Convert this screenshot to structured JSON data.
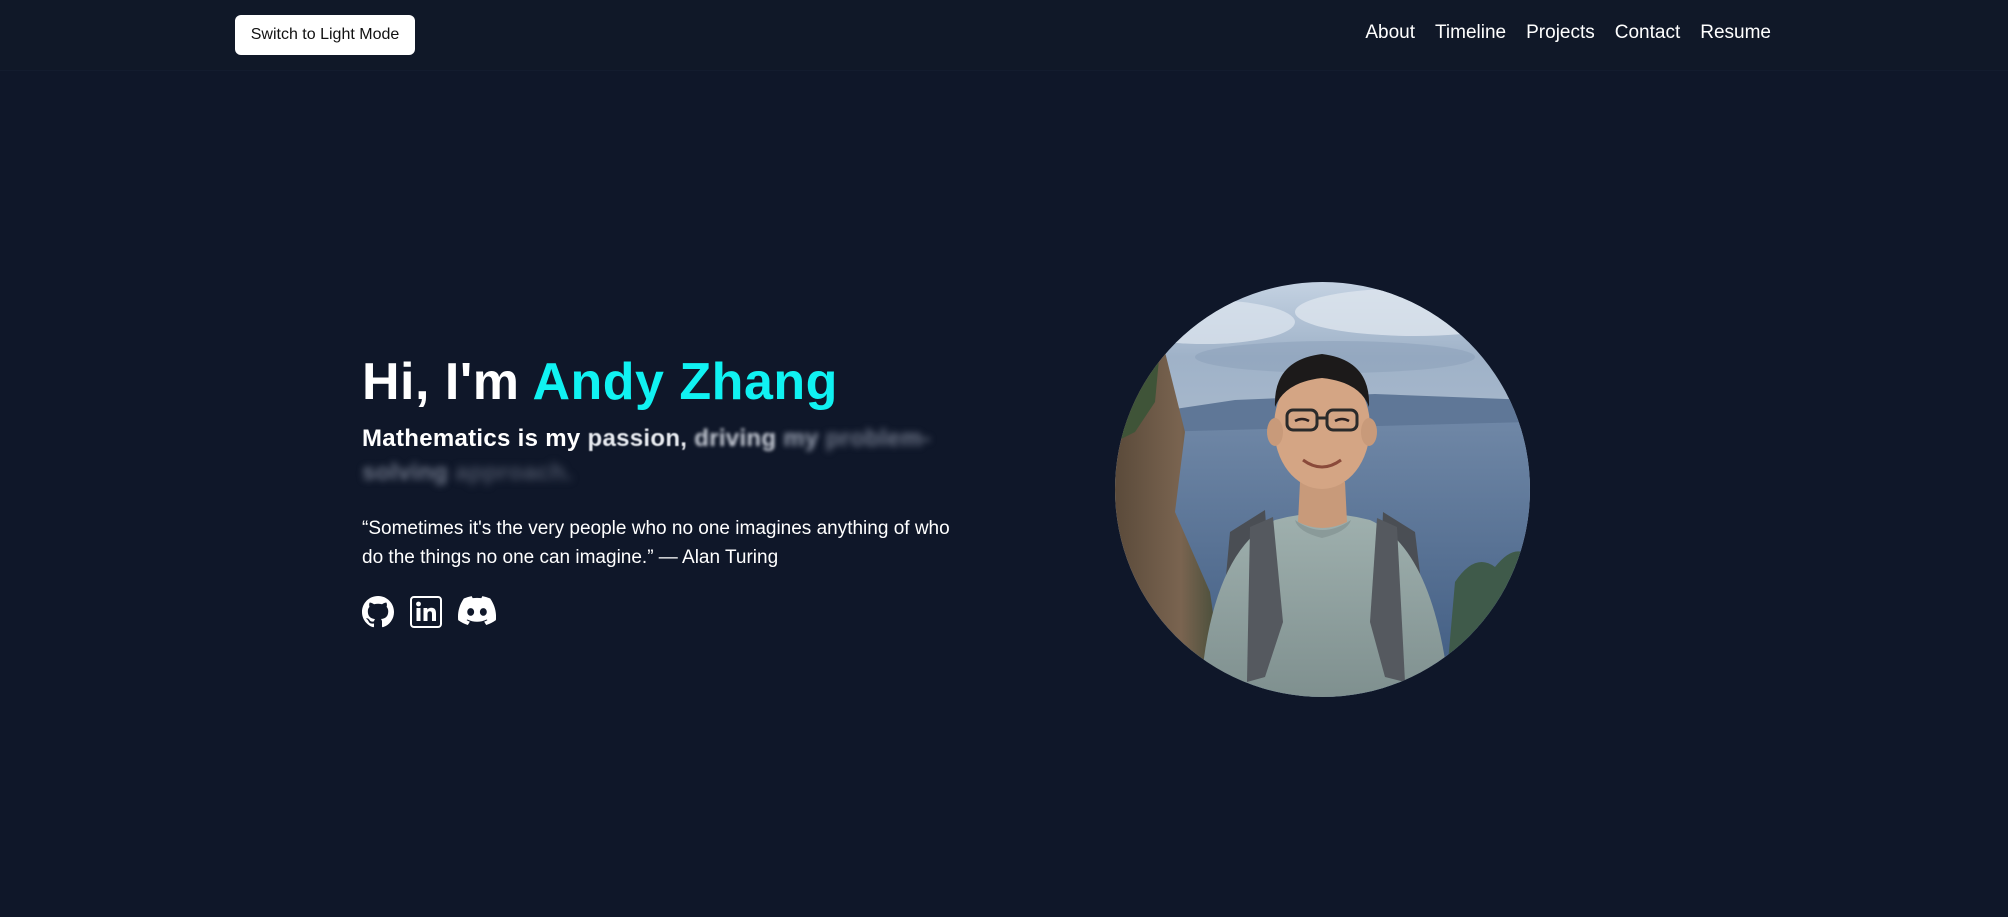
{
  "nav": {
    "theme_toggle_label": "Switch to Light Mode",
    "links": [
      "About",
      "Timeline",
      "Projects",
      "Contact",
      "Resume"
    ]
  },
  "hero": {
    "greeting": "Hi, I'm ",
    "name": "Andy Zhang",
    "tagline_words": [
      "Mathematics is my",
      "passion,",
      "driving",
      "my",
      "problem-",
      "solving",
      "approach."
    ],
    "quote": "“Sometimes it's the very people who no one imagines anything of who do the things no one can imagine.” — Alan Turing",
    "social_icons": [
      "github-icon",
      "linkedin-icon",
      "discord-icon"
    ]
  },
  "colors": {
    "background": "#0f1729",
    "accent": "#10f2f2",
    "text": "#ffffff"
  }
}
